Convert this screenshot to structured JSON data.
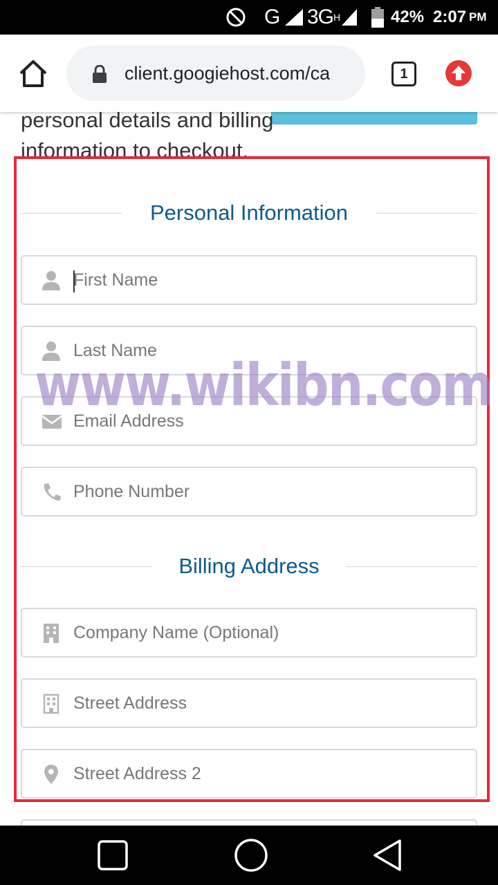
{
  "status_bar": {
    "network_letter": "G",
    "network_type": "3G",
    "network_sup": "H",
    "battery_percent": "42%",
    "time": "2:07",
    "time_period": "PM"
  },
  "browser": {
    "url": "client.googiehost.com/ca",
    "tab_count": "1"
  },
  "page": {
    "intro_text": "personal details and billing information to checkout.",
    "watermark": "www.wikibn.com",
    "personal_heading": "Personal Information",
    "billing_heading": "Billing Address",
    "fields": {
      "first_name": "First Name",
      "last_name": "Last Name",
      "email": "Email Address",
      "phone": "Phone Number",
      "company": "Company Name (Optional)",
      "street": "Street Address",
      "street2": "Street Address 2"
    }
  },
  "colors": {
    "heading": "#0d5a8c",
    "highlight": "#e8283c",
    "update_button": "#e53935"
  }
}
